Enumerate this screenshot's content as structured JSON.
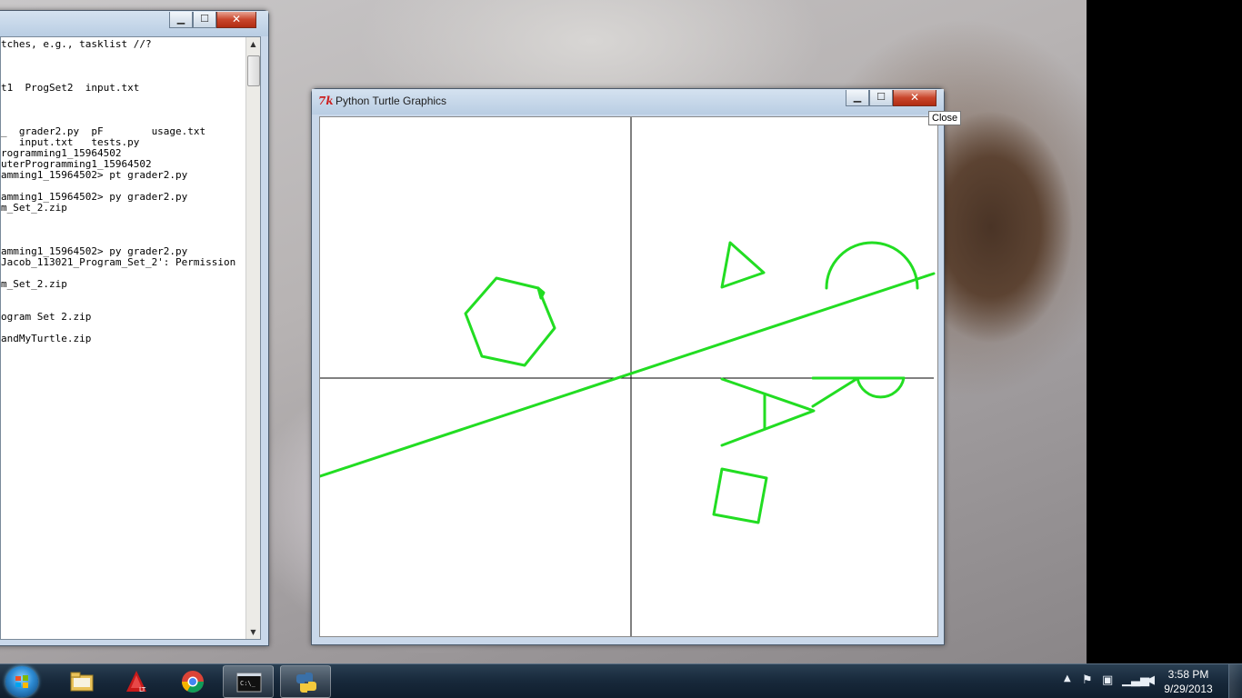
{
  "console": {
    "lines": [
      "tches, e.g., tasklist //?",
      "",
      "",
      "",
      "t1  ProgSet2  input.txt",
      "",
      "",
      "",
      "_  grader2.py  pF        usage.txt",
      "   input.txt   tests.py",
      "rogramming1_15964502",
      "uterProgramming1_15964502",
      "amming1_15964502> pt grader2.py",
      "",
      "amming1_15964502> py grader2.py",
      "m_Set_2.zip",
      "",
      "",
      "",
      "amming1_15964502> py grader2.py",
      "Jacob_113021_Program_Set_2': Permission",
      "",
      "m_Set_2.zip",
      "",
      "",
      "ogram Set 2.zip",
      "",
      "andMyTurtle.zip"
    ]
  },
  "turtle_window": {
    "title": "Python Turtle Graphics",
    "app_icon": "tk-feather-icon",
    "pen_color": "#22dd22",
    "axis_color": "#000000"
  },
  "tooltip": {
    "text": "Close"
  },
  "taskbar": {
    "pinned": [
      {
        "name": "start-button",
        "icon": "windows-orb-icon"
      },
      {
        "name": "explorer",
        "icon": "folder-icon"
      },
      {
        "name": "autocad-lt",
        "icon": "autocad-icon"
      },
      {
        "name": "chrome",
        "icon": "chrome-icon"
      },
      {
        "name": "command-prompt",
        "icon": "cmd-icon"
      },
      {
        "name": "python",
        "icon": "python-icon"
      }
    ],
    "clock": {
      "time": "3:58 PM",
      "date": "9/29/2013"
    }
  },
  "window_buttons": {
    "minimize": "▁",
    "maximize": "☐",
    "close": "✕"
  }
}
